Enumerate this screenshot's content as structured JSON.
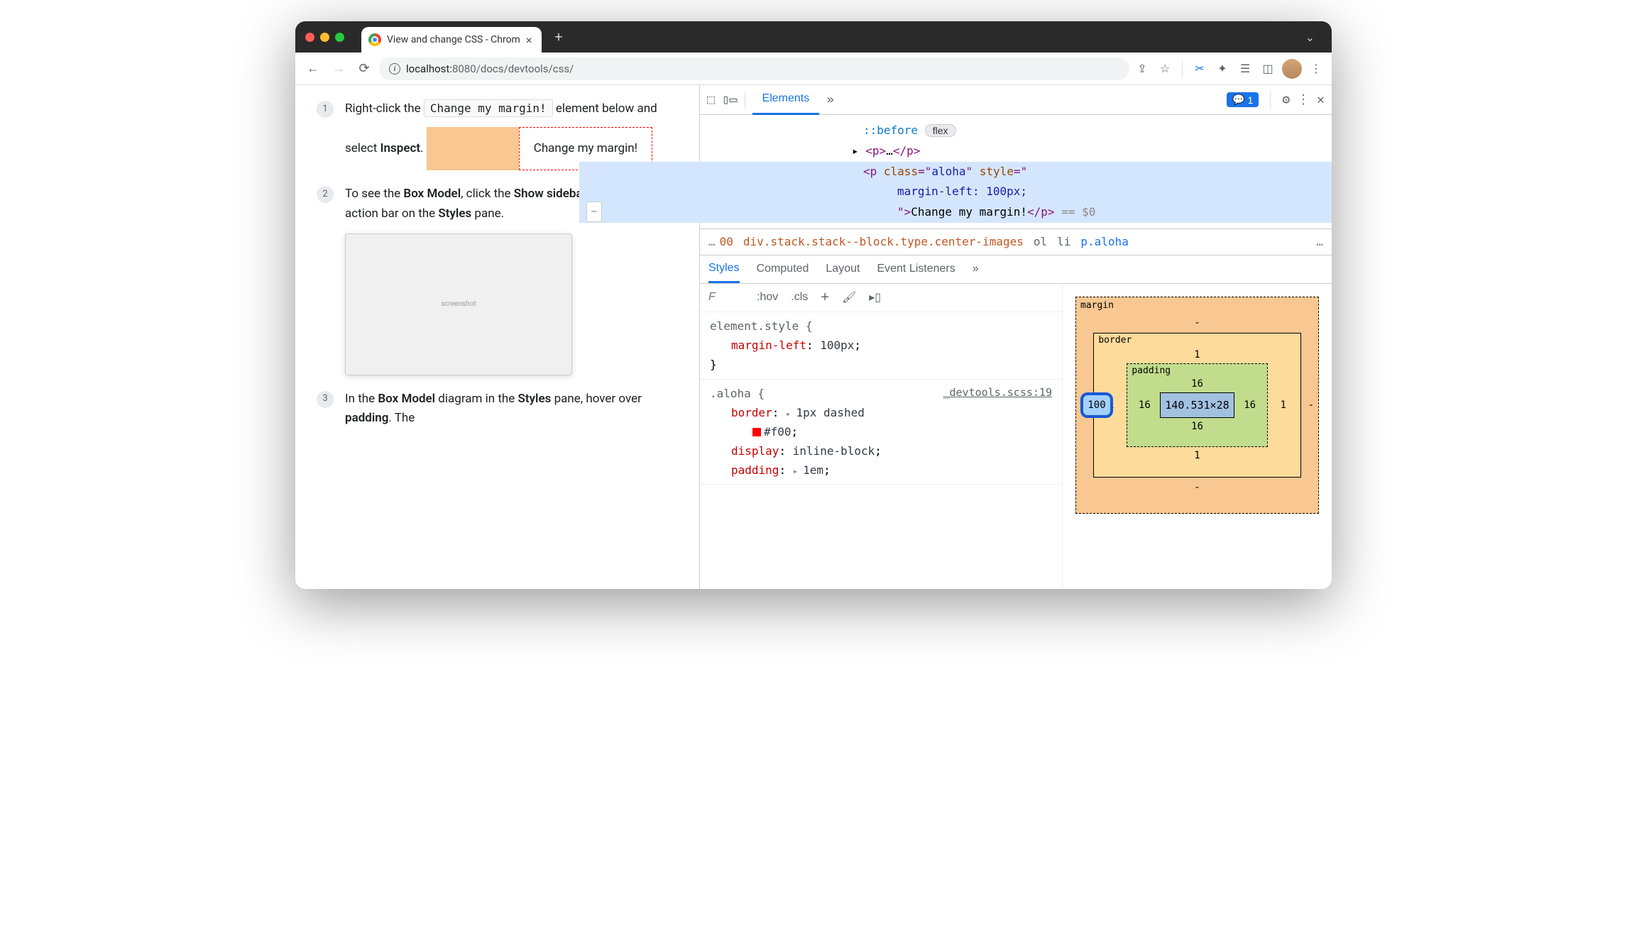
{
  "tab": {
    "title": "View and change CSS - Chrom"
  },
  "url": {
    "host": "localhost:",
    "port": "8080",
    "path": "/docs/devtools/css/"
  },
  "steps": {
    "s1": {
      "num": "1",
      "text_pre": "Right-click the ",
      "code": "Change my margin!",
      "text_post": " element below and select ",
      "bold": "Inspect",
      "period": "."
    },
    "demo": "Change my margin!",
    "s2": {
      "num": "2",
      "t1": "To see the ",
      "b1": "Box Model",
      "t2": ", click the ",
      "b2": "Show sidebar",
      "t3": " button in the action bar on the ",
      "b3": "Styles",
      "t4": " pane."
    },
    "s3": {
      "num": "3",
      "t1": "In the ",
      "b1": "Box Model",
      "t2": " diagram in the ",
      "b2": "Styles",
      "t3": " pane, hover over ",
      "b3": "padding",
      "t4": ". The"
    }
  },
  "devtools": {
    "tabs": {
      "elements": "Elements"
    },
    "badge_count": "1",
    "dom": {
      "before": "::before",
      "flex_pill": "flex",
      "p_collapsed": "<p>…</p>",
      "sel_open": "<p class=\"aloha\" style=\"",
      "sel_style": "margin-left: 100px;",
      "sel_text": "\">Change my margin!</p>",
      "eqd": "== $0"
    },
    "crumbs": {
      "ellipsis": "…",
      "partial": "00",
      "long": "div.stack.stack--block.type.center-images",
      "ol": "ol",
      "li": "li",
      "sel": "p.aloha",
      "ellipsis2": "…"
    },
    "styles_tabs": {
      "styles": "Styles",
      "computed": "Computed",
      "layout": "Layout",
      "listeners": "Event Listeners"
    },
    "filter": {
      "placeholder": "F",
      "hov": ":hov",
      "cls": ".cls",
      "plus": "+"
    },
    "rules": {
      "r1": {
        "selector": "element.style {",
        "prop": "margin-left",
        "val": "100px",
        "close": "}"
      },
      "r2": {
        "selector": ".aloha {",
        "src": "_devtools.scss:19",
        "p1": "border",
        "v1": "1px dashed",
        "v1b": "#f00",
        "p2": "display",
        "v2": "inline-block",
        "p3": "padding",
        "v3": "1em"
      }
    },
    "boxmodel": {
      "margin_label": "margin",
      "margin_top": "-",
      "margin_right": "-",
      "margin_bottom": "-",
      "margin_left": "100",
      "border_label": "border",
      "border_top": "1",
      "border_right": "1",
      "border_bottom": "1",
      "border_left": "1",
      "padding_label": "padding",
      "padding_top": "16",
      "padding_right": "16",
      "padding_bottom": "16",
      "padding_left": "16",
      "content": "140.531×28"
    }
  }
}
